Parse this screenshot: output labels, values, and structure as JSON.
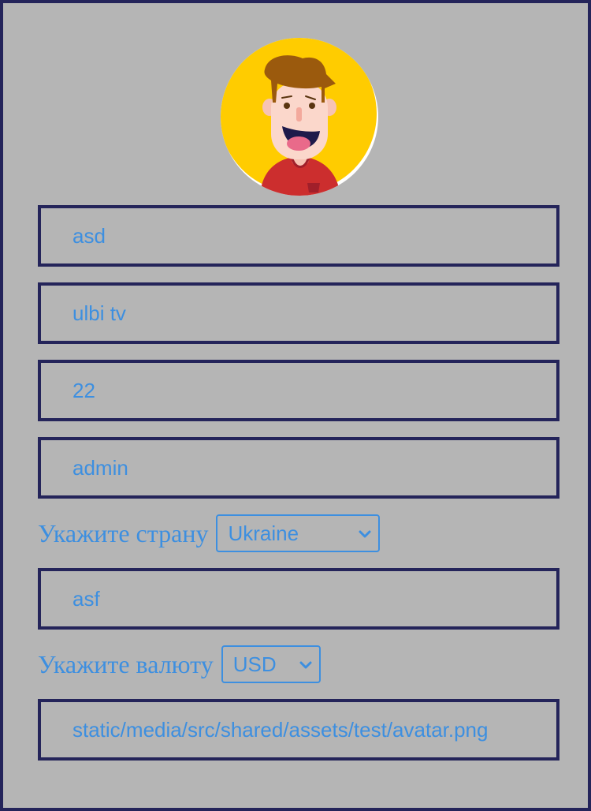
{
  "profile": {
    "avatar_icon": "cartoon-avatar",
    "first_name": "asd",
    "last_name": "ulbi tv",
    "age": "22",
    "username": "admin",
    "country_label": "Укажите страну",
    "country_selected": "Ukraine",
    "city": "asf",
    "currency_label": "Укажите валюту",
    "currency_selected": "USD",
    "avatar_path": "static/media/src/shared/assets/test/avatar.png"
  },
  "colors": {
    "background": "#b5b5b5",
    "border": "#24245a",
    "text": "#3d8fe0",
    "avatar_bg": "#ffcc00"
  }
}
